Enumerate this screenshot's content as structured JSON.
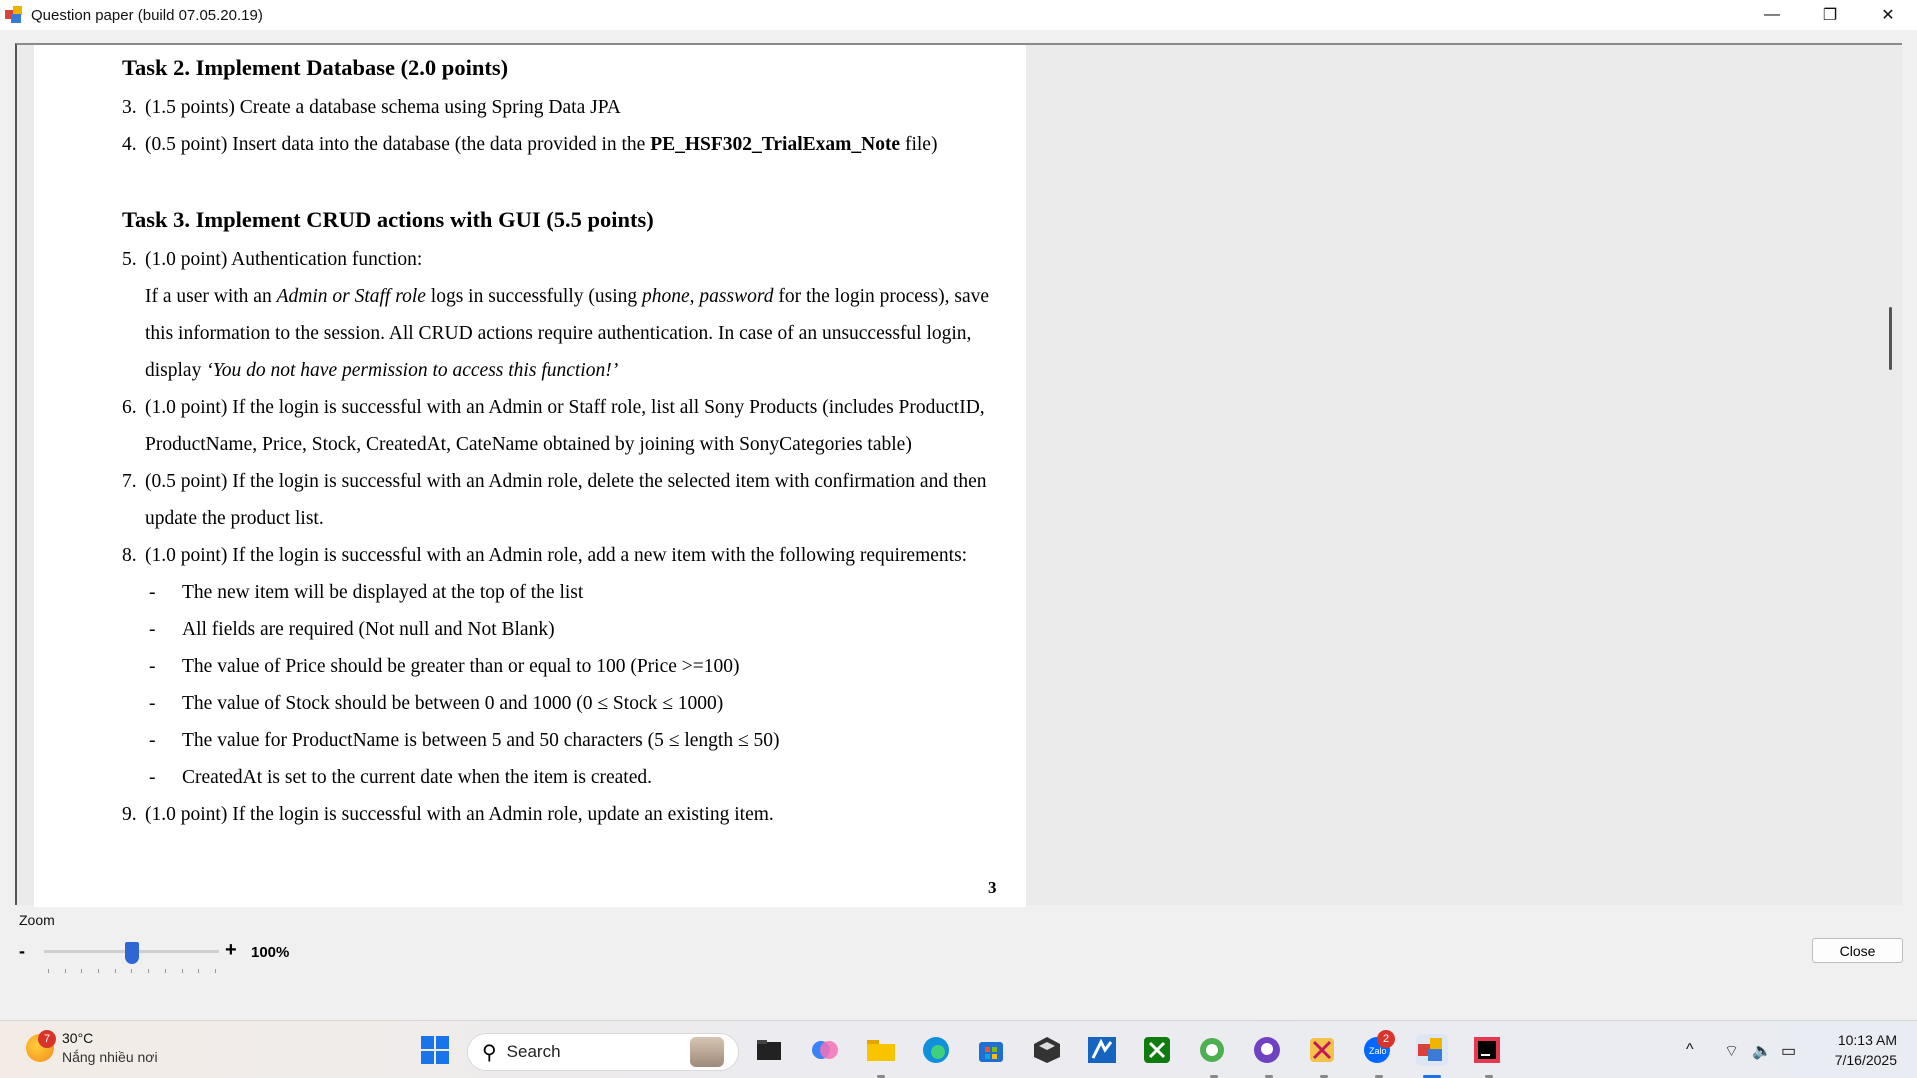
{
  "window": {
    "title": "Question paper (build 07.05.20.19)",
    "minimize_glyph": "—",
    "restore_glyph": "❐",
    "close_glyph": "✕"
  },
  "document": {
    "task2_heading": "Task 2. Implement Database (2.0 points)",
    "item3_num": "3.",
    "item3_text": "(1.5 points) Create a database schema using Spring Data JPA",
    "item4_num": "4.",
    "item4_pre": "(0.5 point) Insert data into the database (the data provided in the ",
    "item4_bold": "PE_HSF302_TrialExam_Note",
    "item4_post": " file)",
    "task3_heading": "Task 3. Implement CRUD actions with GUI (5.5 points)",
    "item5_num": "5.",
    "item5_text": "(1.0 point) Authentication function:",
    "item5_l1_a": "If a user with an ",
    "item5_l1_b": "Admin or Staff role",
    "item5_l1_c": " logs in successfully (using ",
    "item5_l1_d": "phone",
    "item5_l1_e": ", ",
    "item5_l1_f": "password",
    "item5_l1_g": " for the login process), save",
    "item5_l2": "this information to the session. All CRUD actions require authentication. In case of an unsuccessful login,",
    "item5_l3_a": "display ",
    "item5_l3_b": "‘You do not have permission to access this function!’",
    "item6_num": "6.",
    "item6_l1": "(1.0 point) If the login is successful with an Admin or Staff role, list all Sony Products (includes ProductID,",
    "item6_l2": "ProductName, Price, Stock, CreatedAt, CateName obtained by joining with SonyCategories table)",
    "item7_num": "7.",
    "item7_l1": "(0.5 point) If the login is successful with an Admin role, delete the selected item with confirmation and then",
    "item7_l2": "update the product list.",
    "item8_num": "8.",
    "item8_text": "(1.0 point) If the login is successful with an Admin role, add a new item with the following requirements:",
    "dash": "-",
    "bullets": [
      "The new item will be displayed at the top of the list",
      "All fields are required (Not null and Not Blank)",
      "The value of Price should be greater than or equal to 100 (Price >=100)",
      "The value of Stock should be between 0 and 1000 (0 ≤ Stock ≤ 1000)",
      "The value for ProductName is between 5 and 50 characters (5 ≤ length ≤ 50)",
      "CreatedAt is set to the current date when the item is created."
    ],
    "item9_num": "9.",
    "item9_text": "(1.0 point) If the login is successful with an Admin role, update an existing item.",
    "page_number": "3"
  },
  "zoom": {
    "label": "Zoom",
    "minus": "-",
    "plus": "+",
    "value": "100%",
    "slider_fraction": 0.5
  },
  "close_button": "Close",
  "taskbar": {
    "weather_temp": "30°C",
    "weather_desc": "Nắng nhiều nơi",
    "weather_badge": "7",
    "search_placeholder": "Search",
    "zalo_badge": "2",
    "time": "10:13 AM",
    "date": "7/16/2025",
    "apps": [
      "start-icon",
      "file-manager-icon",
      "copilot-icon",
      "file-explorer-icon",
      "edge-icon",
      "store-icon",
      "unity-icon",
      "azure-data-studio-icon",
      "xbox-icon",
      "browser-icon",
      "github-desktop-icon",
      "snipping-tool-icon",
      "zalo-icon",
      "question-paper-app-icon",
      "intellij-icon"
    ]
  },
  "colors": {
    "accent": "#2f66d4",
    "badge": "#d9342b"
  }
}
